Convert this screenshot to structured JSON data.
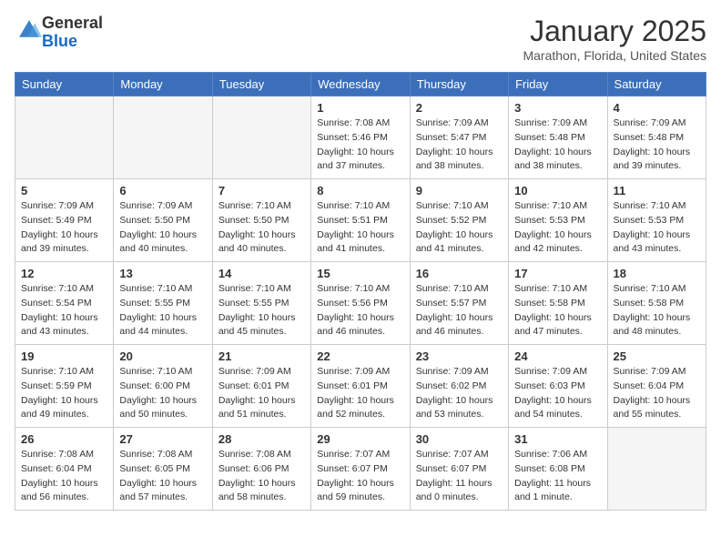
{
  "header": {
    "logo_general": "General",
    "logo_blue": "Blue",
    "month_title": "January 2025",
    "location": "Marathon, Florida, United States"
  },
  "days_of_week": [
    "Sunday",
    "Monday",
    "Tuesday",
    "Wednesday",
    "Thursday",
    "Friday",
    "Saturday"
  ],
  "weeks": [
    [
      {
        "day": "",
        "info": ""
      },
      {
        "day": "",
        "info": ""
      },
      {
        "day": "",
        "info": ""
      },
      {
        "day": "1",
        "info": "Sunrise: 7:08 AM\nSunset: 5:46 PM\nDaylight: 10 hours\nand 37 minutes."
      },
      {
        "day": "2",
        "info": "Sunrise: 7:09 AM\nSunset: 5:47 PM\nDaylight: 10 hours\nand 38 minutes."
      },
      {
        "day": "3",
        "info": "Sunrise: 7:09 AM\nSunset: 5:48 PM\nDaylight: 10 hours\nand 38 minutes."
      },
      {
        "day": "4",
        "info": "Sunrise: 7:09 AM\nSunset: 5:48 PM\nDaylight: 10 hours\nand 39 minutes."
      }
    ],
    [
      {
        "day": "5",
        "info": "Sunrise: 7:09 AM\nSunset: 5:49 PM\nDaylight: 10 hours\nand 39 minutes."
      },
      {
        "day": "6",
        "info": "Sunrise: 7:09 AM\nSunset: 5:50 PM\nDaylight: 10 hours\nand 40 minutes."
      },
      {
        "day": "7",
        "info": "Sunrise: 7:10 AM\nSunset: 5:50 PM\nDaylight: 10 hours\nand 40 minutes."
      },
      {
        "day": "8",
        "info": "Sunrise: 7:10 AM\nSunset: 5:51 PM\nDaylight: 10 hours\nand 41 minutes."
      },
      {
        "day": "9",
        "info": "Sunrise: 7:10 AM\nSunset: 5:52 PM\nDaylight: 10 hours\nand 41 minutes."
      },
      {
        "day": "10",
        "info": "Sunrise: 7:10 AM\nSunset: 5:53 PM\nDaylight: 10 hours\nand 42 minutes."
      },
      {
        "day": "11",
        "info": "Sunrise: 7:10 AM\nSunset: 5:53 PM\nDaylight: 10 hours\nand 43 minutes."
      }
    ],
    [
      {
        "day": "12",
        "info": "Sunrise: 7:10 AM\nSunset: 5:54 PM\nDaylight: 10 hours\nand 43 minutes."
      },
      {
        "day": "13",
        "info": "Sunrise: 7:10 AM\nSunset: 5:55 PM\nDaylight: 10 hours\nand 44 minutes."
      },
      {
        "day": "14",
        "info": "Sunrise: 7:10 AM\nSunset: 5:55 PM\nDaylight: 10 hours\nand 45 minutes."
      },
      {
        "day": "15",
        "info": "Sunrise: 7:10 AM\nSunset: 5:56 PM\nDaylight: 10 hours\nand 46 minutes."
      },
      {
        "day": "16",
        "info": "Sunrise: 7:10 AM\nSunset: 5:57 PM\nDaylight: 10 hours\nand 46 minutes."
      },
      {
        "day": "17",
        "info": "Sunrise: 7:10 AM\nSunset: 5:58 PM\nDaylight: 10 hours\nand 47 minutes."
      },
      {
        "day": "18",
        "info": "Sunrise: 7:10 AM\nSunset: 5:58 PM\nDaylight: 10 hours\nand 48 minutes."
      }
    ],
    [
      {
        "day": "19",
        "info": "Sunrise: 7:10 AM\nSunset: 5:59 PM\nDaylight: 10 hours\nand 49 minutes."
      },
      {
        "day": "20",
        "info": "Sunrise: 7:10 AM\nSunset: 6:00 PM\nDaylight: 10 hours\nand 50 minutes."
      },
      {
        "day": "21",
        "info": "Sunrise: 7:09 AM\nSunset: 6:01 PM\nDaylight: 10 hours\nand 51 minutes."
      },
      {
        "day": "22",
        "info": "Sunrise: 7:09 AM\nSunset: 6:01 PM\nDaylight: 10 hours\nand 52 minutes."
      },
      {
        "day": "23",
        "info": "Sunrise: 7:09 AM\nSunset: 6:02 PM\nDaylight: 10 hours\nand 53 minutes."
      },
      {
        "day": "24",
        "info": "Sunrise: 7:09 AM\nSunset: 6:03 PM\nDaylight: 10 hours\nand 54 minutes."
      },
      {
        "day": "25",
        "info": "Sunrise: 7:09 AM\nSunset: 6:04 PM\nDaylight: 10 hours\nand 55 minutes."
      }
    ],
    [
      {
        "day": "26",
        "info": "Sunrise: 7:08 AM\nSunset: 6:04 PM\nDaylight: 10 hours\nand 56 minutes."
      },
      {
        "day": "27",
        "info": "Sunrise: 7:08 AM\nSunset: 6:05 PM\nDaylight: 10 hours\nand 57 minutes."
      },
      {
        "day": "28",
        "info": "Sunrise: 7:08 AM\nSunset: 6:06 PM\nDaylight: 10 hours\nand 58 minutes."
      },
      {
        "day": "29",
        "info": "Sunrise: 7:07 AM\nSunset: 6:07 PM\nDaylight: 10 hours\nand 59 minutes."
      },
      {
        "day": "30",
        "info": "Sunrise: 7:07 AM\nSunset: 6:07 PM\nDaylight: 11 hours\nand 0 minutes."
      },
      {
        "day": "31",
        "info": "Sunrise: 7:06 AM\nSunset: 6:08 PM\nDaylight: 11 hours\nand 1 minute."
      },
      {
        "day": "",
        "info": ""
      }
    ]
  ]
}
